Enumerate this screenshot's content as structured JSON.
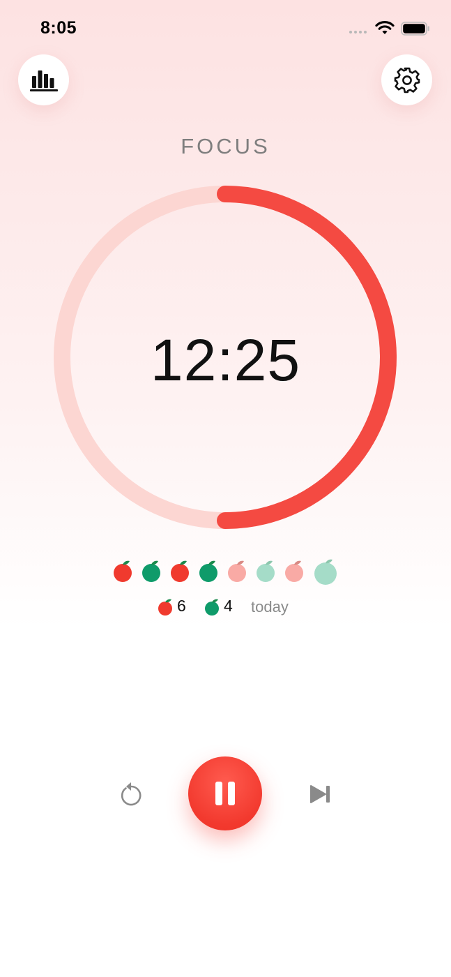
{
  "status_bar": {
    "time": "8:05"
  },
  "header": {
    "stats_icon": "bar-chart-icon",
    "settings_icon": "gear-icon"
  },
  "mode_label": "FOCUS",
  "timer": {
    "display": "12:25",
    "progress": 0.5
  },
  "sessions": {
    "tomatoes": [
      {
        "kind": "focus",
        "state": "done"
      },
      {
        "kind": "break",
        "state": "done"
      },
      {
        "kind": "focus",
        "state": "done"
      },
      {
        "kind": "break",
        "state": "done"
      },
      {
        "kind": "focus",
        "state": "pending"
      },
      {
        "kind": "break",
        "state": "pending"
      },
      {
        "kind": "focus",
        "state": "pending"
      },
      {
        "kind": "long-break",
        "state": "pending"
      }
    ],
    "summary": {
      "focus_count": "6",
      "break_count": "4",
      "period_label": "today"
    }
  },
  "controls": {
    "reset_icon": "reset-icon",
    "pause_icon": "pause-icon",
    "skip_icon": "skip-icon"
  },
  "colors": {
    "accent": "#f44a42",
    "track": "#fcd6d2",
    "focus_tomato": "#f03a2e",
    "break_tomato": "#0f9b6a",
    "focus_tomato_pending": "#f9aaa5",
    "break_tomato_pending": "#a5dcc8",
    "leaf": "#1b8a4c"
  }
}
